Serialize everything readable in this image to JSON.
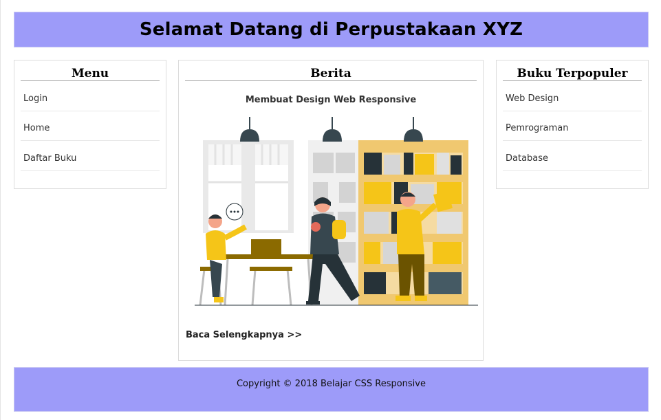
{
  "header": {
    "title": "Selamat Datang di Perpustakaan XYZ"
  },
  "menu": {
    "title": "Menu",
    "items": [
      {
        "label": "Login"
      },
      {
        "label": "Home"
      },
      {
        "label": "Daftar Buku"
      }
    ]
  },
  "news": {
    "title": "Berita",
    "article_title": "Membuat Design Web Responsive",
    "read_more": "Baca Selengkapnya >>",
    "illustration": "library-illustration"
  },
  "popular": {
    "title": "Buku Terpopuler",
    "items": [
      {
        "label": "Web Design"
      },
      {
        "label": "Pemrograman"
      },
      {
        "label": "Database"
      }
    ]
  },
  "footer": {
    "text": "Copyright © 2018 Belajar CSS Responsive"
  },
  "colors": {
    "header_bg": "#9d9bf9",
    "footer_bg": "#9d9bf9",
    "accent_yellow": "#f4c430"
  }
}
